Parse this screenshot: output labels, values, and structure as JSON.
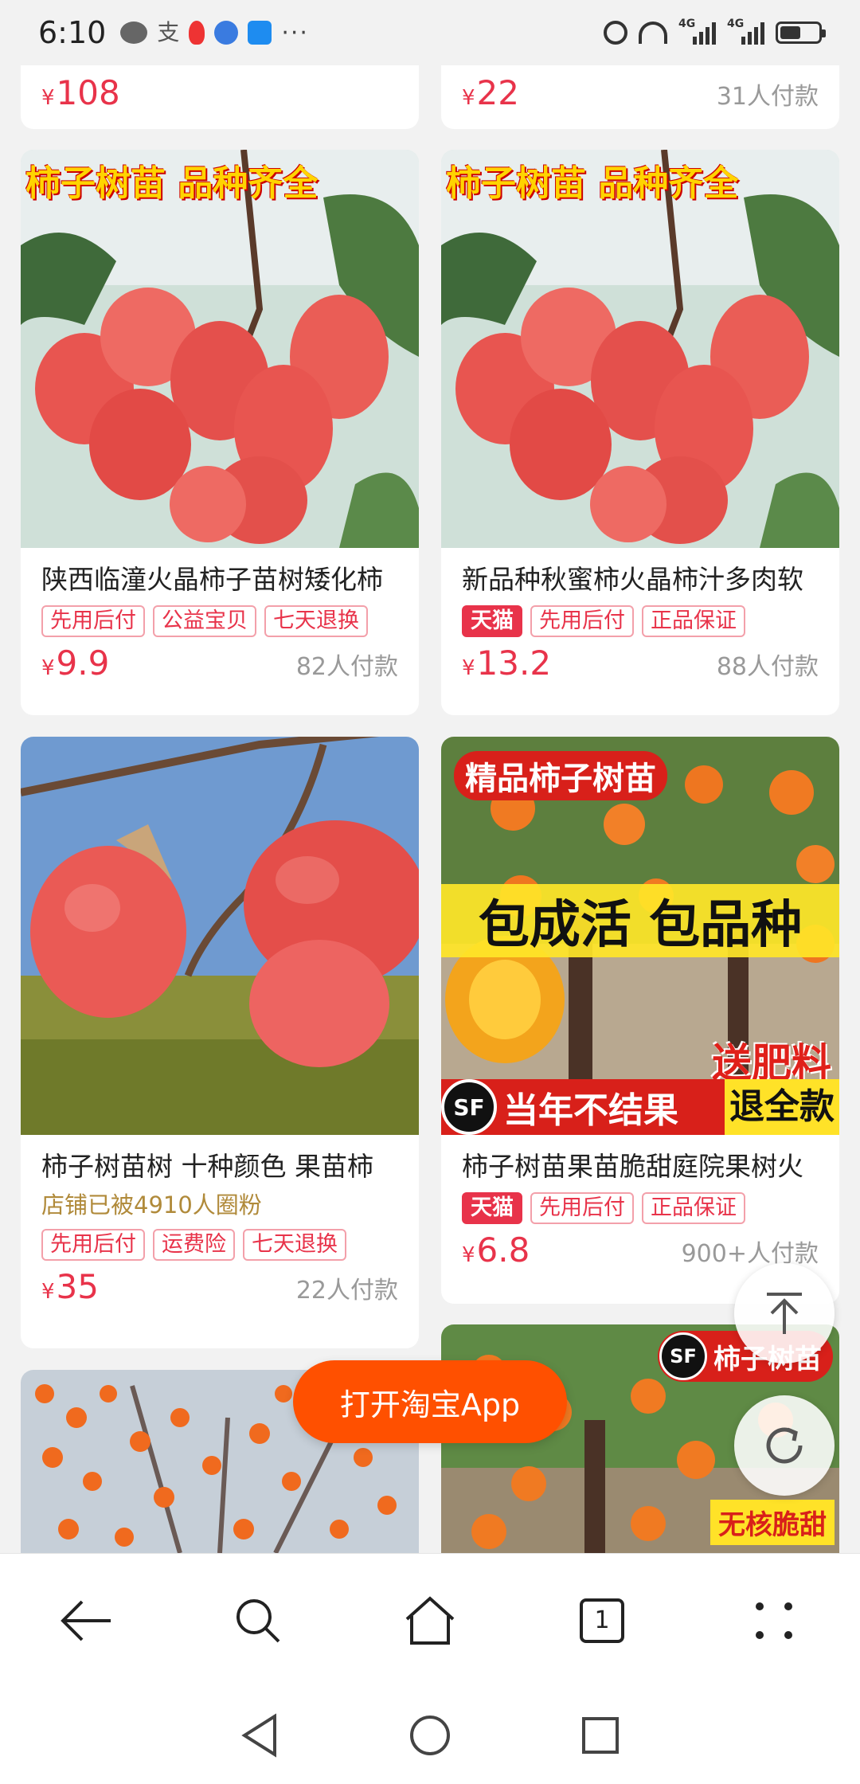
{
  "status_bar": {
    "time": "6:10",
    "alipay_glyph": "支",
    "more_dots": "···",
    "net1": "4G",
    "net2": "4G"
  },
  "top_row": [
    {
      "price": "108",
      "sold": ""
    },
    {
      "price": "22",
      "sold": "31人付款"
    }
  ],
  "currency": "¥",
  "products": [
    {
      "banner": "柿子树苗  品种齐全",
      "title": "陕西临潼火晶柿子苗树矮化柿",
      "tags": [
        "先用后付",
        "公益宝贝",
        "七天退换"
      ],
      "price": "9.9",
      "sold": "82人付款"
    },
    {
      "banner": "柿子树苗  品种齐全",
      "title": "新品种秋蜜柿火晶柿汁多肉软",
      "tmall": "天猫",
      "tags": [
        "先用后付",
        "正品保证"
      ],
      "price": "13.2",
      "sold": "88人付款"
    },
    {
      "title": "柿子树苗树 十种颜色 果苗柿",
      "shop": "店铺已被4910人圈粉",
      "tags": [
        "先用后付",
        "运费险",
        "七天退换"
      ],
      "price": "35",
      "sold": "22人付款"
    },
    {
      "banner_top": "精品柿子树苗",
      "banner_mid": "包成活 包品种",
      "banner_gift": "送肥料",
      "banner_bottom_a": "当年不结果",
      "banner_bottom_b": "退全款",
      "sf": "SF",
      "title": "柿子树苗果苗脆甜庭院果树火",
      "tmall": "天猫",
      "tags": [
        "先用后付",
        "正品保证"
      ],
      "price": "6.8",
      "sold": "900+人付款"
    },
    {
      "banner_top": "柿子树苗",
      "banner_bottom": "无核脆甜",
      "sf": "SF"
    }
  ],
  "open_app_label": "打开淘宝App",
  "tabs_count": "1",
  "icons": {
    "back": "arrow-left-icon",
    "search": "search-icon",
    "home": "home-icon",
    "tabs": "tabs-icon",
    "menu": "menu-dots-icon",
    "to_top": "arrow-up-icon",
    "refresh": "refresh-icon"
  },
  "colors": {
    "accent": "#e8334a",
    "taobao_orange": "#ff5000"
  }
}
